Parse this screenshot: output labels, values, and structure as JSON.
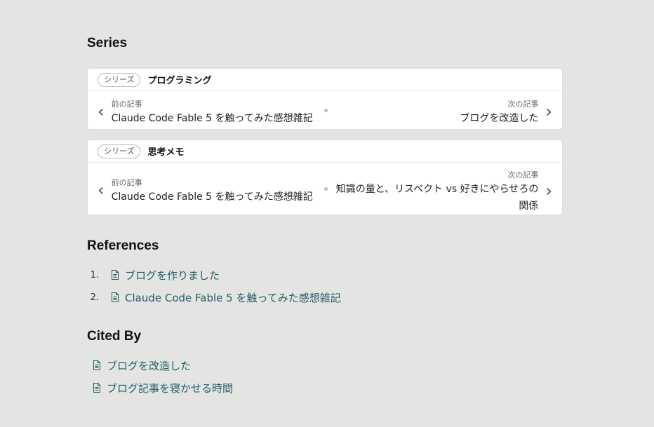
{
  "sections": {
    "series_heading": "Series",
    "references_heading": "References",
    "cited_by_heading": "Cited By"
  },
  "series": [
    {
      "badge": "シリーズ",
      "name": "プログラミング",
      "prev_label": "前の記事",
      "prev_title": "Claude Code Fable 5 を触ってみた感想雑記",
      "next_label": "次の記事",
      "next_title_line1": "ブログを改造した",
      "next_title_line2": ""
    },
    {
      "badge": "シリーズ",
      "name": "思考メモ",
      "prev_label": "前の記事",
      "prev_title": "Claude Code Fable 5 を触ってみた感想雑記",
      "next_label": "次の記事",
      "next_title_line1": "知識の量と、リスペクト vs 好きにやらせろの",
      "next_title_line2": "関係"
    }
  ],
  "references": [
    {
      "num": "1.",
      "title": "ブログを作りました"
    },
    {
      "num": "2.",
      "title": "Claude Code Fable 5 を触ってみた感想雑記"
    }
  ],
  "cited_by": [
    {
      "title": "ブログを改造した"
    },
    {
      "title": "ブログ記事を寝かせる時間"
    }
  ],
  "icons": {
    "prev": "chevron-left-icon",
    "next": "chevron-right-icon",
    "doc": "document-icon"
  },
  "colors": {
    "accent": "#1f5f66",
    "background": "#e4e4e2"
  }
}
